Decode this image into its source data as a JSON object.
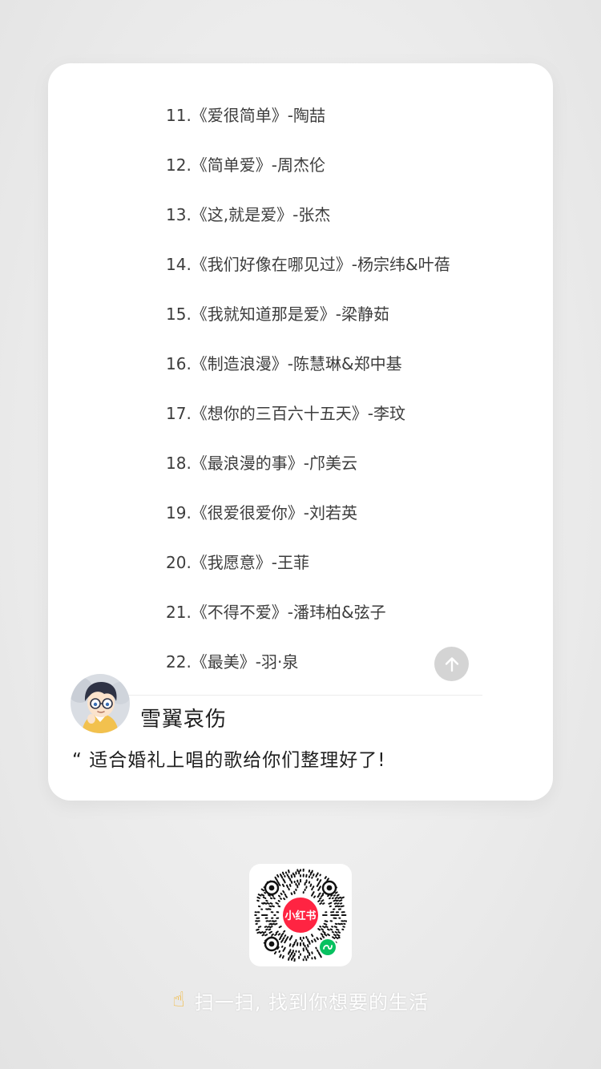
{
  "songs": [
    "11.《爱很简单》-陶喆",
    "12.《简单爱》-周杰伦",
    "13.《这,就是爱》-张杰",
    "14.《我们好像在哪见过》-杨宗纬&叶蓓",
    "15.《我就知道那是爱》-梁静茹",
    "16.《制造浪漫》-陈慧琳&郑中基",
    "17.《想你的三百六十五天》-李玟",
    "18.《最浪漫的事》-邝美云",
    "19.《很爱很爱你》-刘若英",
    "20.《我愿意》-王菲",
    "21.《不得不爱》-潘玮柏&弦子",
    "22.《最美》-羽·泉"
  ],
  "author": {
    "name": "雪翼哀伤",
    "avatar_icon": "anime-character-avatar"
  },
  "note": {
    "quote_mark": "“",
    "description": "适合婚礼上唱的歌给你们整理好了!"
  },
  "qr": {
    "logo_text": "小红书",
    "brand_color": "#ff2442",
    "mini_program_badge_color": "#07c160"
  },
  "footer": {
    "scan_icon": "pointing-hand-icon",
    "scan_text": "扫一扫, 找到你想要的生活"
  },
  "scroll_top_icon": "arrow-up-icon"
}
